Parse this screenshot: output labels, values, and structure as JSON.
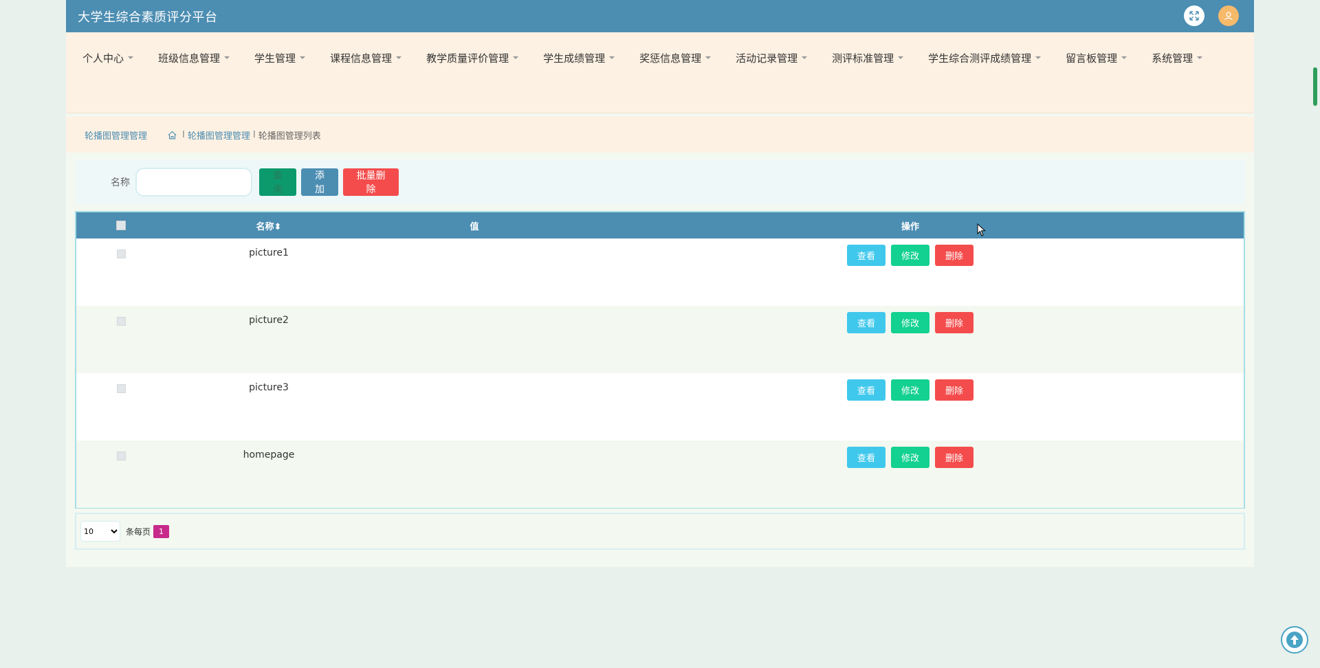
{
  "app": {
    "title": "大学生综合素质评分平台"
  },
  "header_icons": {
    "expand": "expand-icon",
    "user": "user-icon"
  },
  "nav": {
    "items": [
      {
        "label": "个人中心"
      },
      {
        "label": "班级信息管理"
      },
      {
        "label": "学生管理"
      },
      {
        "label": "课程信息管理"
      },
      {
        "label": "教学质量评价管理"
      },
      {
        "label": "学生成绩管理"
      },
      {
        "label": "奖惩信息管理"
      },
      {
        "label": "活动记录管理"
      },
      {
        "label": "测评标准管理"
      },
      {
        "label": "学生综合测评成绩管理"
      },
      {
        "label": "留言板管理"
      },
      {
        "label": "系统管理"
      }
    ]
  },
  "breadcrumb": {
    "title": "轮播图管理管理",
    "sep": "I",
    "link": "轮播图管理管理",
    "current": "轮播图管理列表"
  },
  "search": {
    "label": "名称",
    "value": "",
    "search_btn": "查询",
    "add_btn": "添加",
    "bulk_delete_btn": "批量删除"
  },
  "table": {
    "columns": {
      "name": "名称⬍",
      "value": "值",
      "ops": "操作"
    },
    "ops": {
      "view": "查看",
      "edit": "修改",
      "delete": "删除"
    },
    "rows": [
      {
        "name": "picture1",
        "value": ""
      },
      {
        "name": "picture2",
        "value": ""
      },
      {
        "name": "picture3",
        "value": ""
      },
      {
        "name": "homepage",
        "value": ""
      }
    ]
  },
  "pagination": {
    "page_size": "10",
    "page_size_options": [
      "10"
    ],
    "per_page_label": "条每页",
    "current_page": "1"
  },
  "colors": {
    "header_bg": "#4c8db2",
    "nav_bg": "#fdf1e3",
    "view": "#40c8ec",
    "edit": "#13d190",
    "delete": "#f44c4c",
    "page_active": "#c72a8a"
  }
}
